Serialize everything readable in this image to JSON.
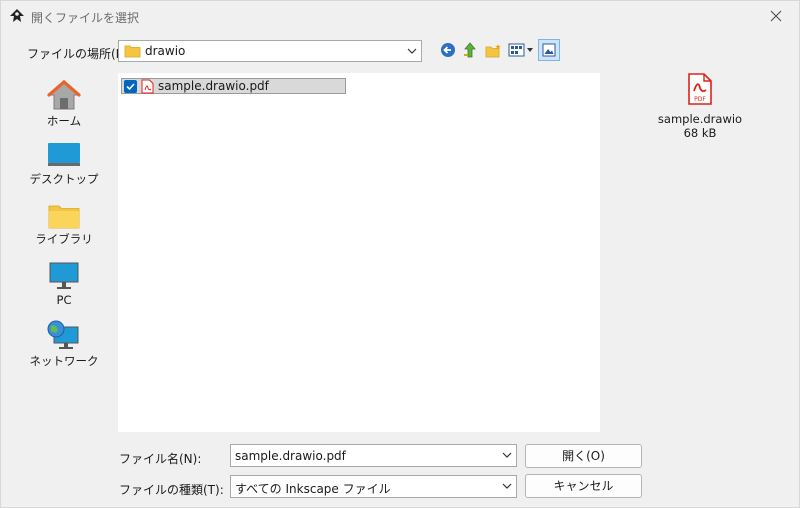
{
  "window": {
    "title": "開くファイルを選択"
  },
  "lookin": {
    "label": "ファイルの場所(I):",
    "value": "drawio"
  },
  "places": [
    {
      "label": "ホーム",
      "icon": "home-icon"
    },
    {
      "label": "デスクトップ",
      "icon": "desktop-icon"
    },
    {
      "label": "ライブラリ",
      "icon": "library-folder-icon"
    },
    {
      "label": "PC",
      "icon": "pc-monitor-icon"
    },
    {
      "label": "ネットワーク",
      "icon": "network-globe-icon"
    }
  ],
  "files": [
    {
      "name": "sample.drawio.pdf",
      "selected": true,
      "icon": "pdf-file-icon"
    }
  ],
  "preview": {
    "name": "sample.drawio",
    "size": "68 kB",
    "icon_text": "PDF"
  },
  "filename": {
    "label": "ファイル名(N):",
    "value": "sample.drawio.pdf"
  },
  "filetype": {
    "label": "ファイルの種類(T):",
    "value": "すべての Inkscape ファイル"
  },
  "buttons": {
    "open": "開く(O)",
    "cancel": "キャンセル"
  },
  "colors": {
    "accent": "#0067c0",
    "pdf_red": "#e0201b",
    "folder": "#f5c542"
  }
}
